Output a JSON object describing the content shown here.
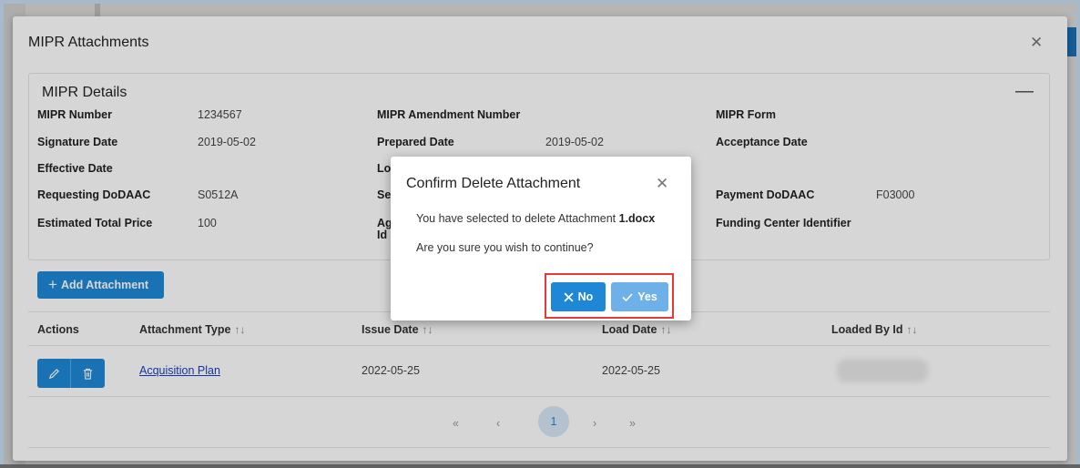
{
  "modal": {
    "title": "MIPR Attachments",
    "close_icon": "close-icon"
  },
  "details": {
    "title": "MIPR Details",
    "collapse_icon": "minus-icon",
    "mipr_number_label": "MIPR Number",
    "mipr_number_value": "1234567",
    "signature_date_label": "Signature Date",
    "signature_date_value": "2019-05-02",
    "effective_date_label": "Effective Date",
    "requesting_dodaac_label": "Requesting DoDAAC",
    "requesting_dodaac_value": "S0512A",
    "estimated_total_price_label": "Estimated Total Price",
    "estimated_total_price_value": "100",
    "amendment_number_label": "MIPR Amendment Number",
    "prepared_date_label": "Prepared Date",
    "prepared_date_value": "2019-05-02",
    "partial_lo": "Lo",
    "partial_se": "Se",
    "partial_ag": "Ag",
    "partial_id": "Id",
    "mipr_form_label": "MIPR Form",
    "acceptance_date_label": "Acceptance Date",
    "payment_dodaac_label": "Payment DoDAAC",
    "payment_dodaac_value": "F03000",
    "funding_center_label": "Funding Center Identifier"
  },
  "add_attachment_label": "Add Attachment",
  "table": {
    "headers": {
      "actions": "Actions",
      "attachment_type": "Attachment Type",
      "issue_date": "Issue Date",
      "load_date": "Load Date",
      "loaded_by": "Loaded By Id"
    },
    "sort_glyph": "↑↓",
    "rows": [
      {
        "attachment_type": "Acquisition Plan",
        "issue_date": "2022-05-25",
        "load_date": "2022-05-25"
      }
    ]
  },
  "pager": {
    "first": "«",
    "prev": "‹",
    "current": "1",
    "next": "›",
    "last": "»"
  },
  "confirm": {
    "title": "Confirm Delete Attachment",
    "message_prefix": "You have selected to delete Attachment",
    "file_name": "1.docx",
    "question": "Are you sure you wish to continue?",
    "no_label": "No",
    "yes_label": "Yes"
  },
  "colors": {
    "primary": "#1e88d6",
    "primary_light": "#6db1e8",
    "highlight_border": "#e53935",
    "link": "#1a3fbf"
  }
}
